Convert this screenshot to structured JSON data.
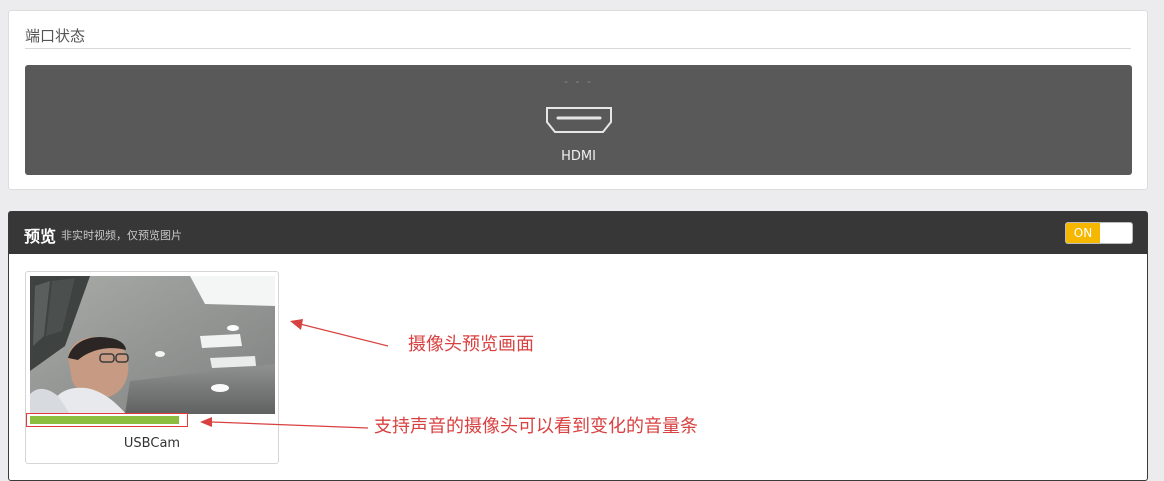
{
  "port_status": {
    "title": "端口状态",
    "dots": "- - -",
    "port_label": "HDMI"
  },
  "preview": {
    "title": "预览",
    "subtitle": "非实时视频，仅预览图片",
    "toggle_label": "ON",
    "toggle_state": "on",
    "camera_name": "USBCam",
    "audio_level": 0.92
  },
  "annotations": {
    "preview_image": "摄像头预览画面",
    "audio_bar": "支持声音的摄像头可以看到变化的音量条"
  },
  "colors": {
    "toggle_on": "#f6b700",
    "header_bg": "#373737",
    "port_box_bg": "#595959",
    "annotation": "#d94141",
    "level_bar": "#8bbd3f"
  }
}
